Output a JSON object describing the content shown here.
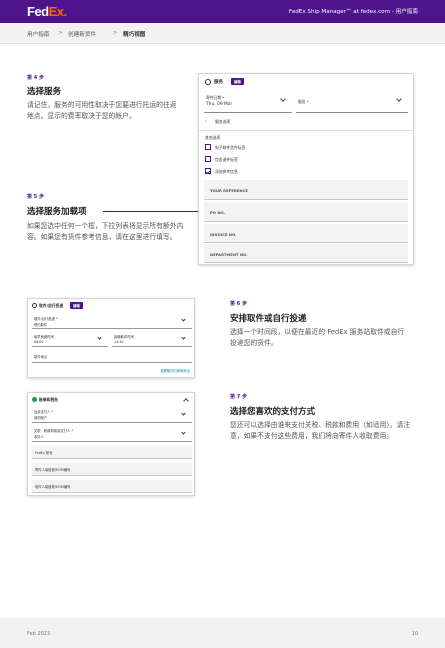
{
  "header": {
    "logo_fed": "Fed",
    "logo_ex": "Ex.",
    "title": "FedEx Ship Manager™ at fedex.com - 用户指南"
  },
  "breadcrumb": {
    "items": [
      "用户指南",
      "创建新货件",
      "精巧视图"
    ],
    "separator": ">"
  },
  "steps": {
    "s4": {
      "label": "第 4 步",
      "title": "选择服务",
      "text": "请记住，服务的可用性取决于您要进行托运的往返地点。显示的费率取决于您的帐户。"
    },
    "s5": {
      "label": "第 5 步",
      "title": "选择服务加载项",
      "text": "如果您选中任何一个框，下拉列表将显示所有额外内容。如果您有货件参考信息，请在这里进行填写。"
    },
    "s6": {
      "label": "第 6 步",
      "title": "安排取件或自行投递",
      "text": "选择一个时间段，以便在最近的 FedEx 服务站取件或自行投递您的货件。"
    },
    "s7": {
      "label": "第 7 步",
      "title": "选择您喜欢的支付方式",
      "text": "您还可以选择由谁来支付关税、税款和费用（如适用）。请注意，如果不支付这些费用，我们将向寄件人收取费用。"
    }
  },
  "service_panel": {
    "title": "服务",
    "badge": "编辑",
    "ship_date_label": "寄件日期 *",
    "ship_date_value": "Thu, 09 Mar",
    "service_label": "服务 *",
    "addons_link": "服务选项",
    "options_heading": "其他选项",
    "options": [
      {
        "label": "电子邮件货件标签",
        "checked": false
      },
      {
        "label": "包含退件标签",
        "checked": false
      },
      {
        "label": "添加参考信息",
        "checked": true
      }
    ],
    "reference_fields": [
      "YOUR REFERENCE",
      "PO NO.",
      "INVOICE NO.",
      "DEPARTMENT NO."
    ]
  },
  "pickup_panel": {
    "title": "取件/自行投递",
    "badge": "编辑",
    "method_label": "取件/自行投递 *",
    "method_value": "预约取件",
    "ready_label": "最早就绪时间",
    "ready_value": "08:00",
    "close_label": "最晚取件时间",
    "close_value": "14:30",
    "location_label": "取件地点",
    "link": "查看取件时间和地点"
  },
  "billing_panel": {
    "title": "账单和税务",
    "bill_to_label": "运费支付人 *",
    "bill_to_value": "我的账户",
    "duties_label": "关税、税款和费用支付人 *",
    "duties_value": "收件人",
    "fields": [
      "FedEx 帐号",
      "寄件人增值税/EORI编号",
      "收件人增值税/EORI编号"
    ]
  },
  "footer": {
    "date": "Feb 2023",
    "page": "10"
  }
}
